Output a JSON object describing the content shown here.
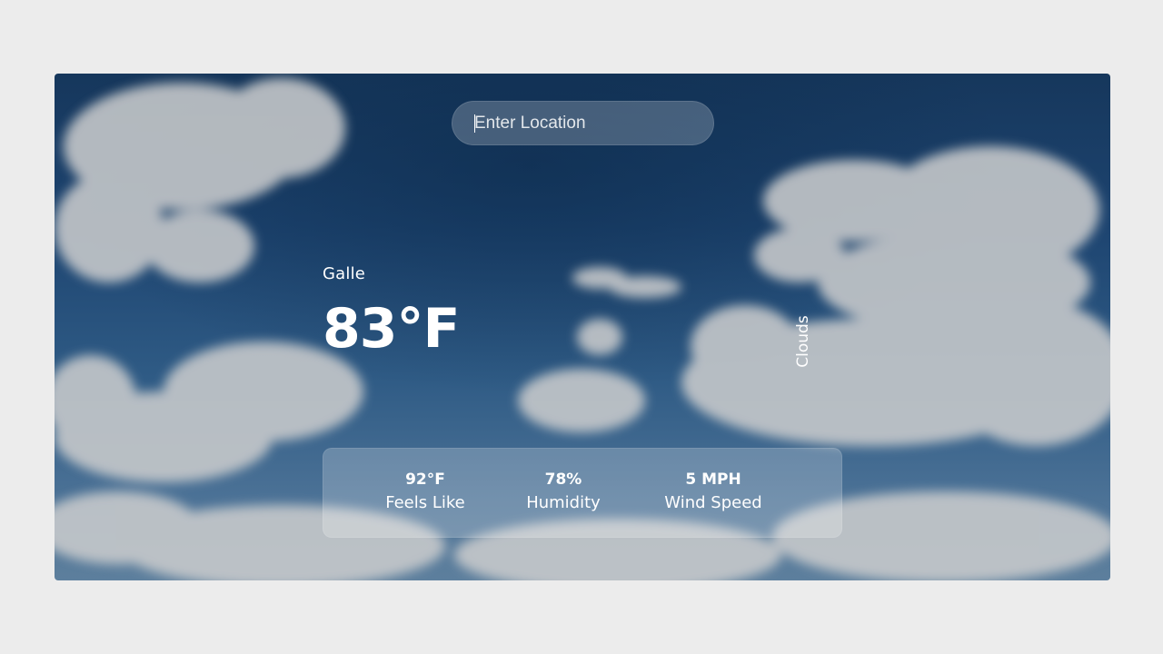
{
  "search": {
    "placeholder": "Enter Location",
    "value": ""
  },
  "weather": {
    "location": "Galle",
    "temperature": "83°F",
    "condition": "Clouds"
  },
  "stats": [
    {
      "value": "92°F",
      "label": "Feels Like"
    },
    {
      "value": "78%",
      "label": "Humidity"
    },
    {
      "value": "5 MPH",
      "label": "Wind Speed"
    }
  ],
  "colors": {
    "page_background": "#ececec",
    "sky_top": "#16375c",
    "sky_bottom": "#5d7f9d",
    "text": "#ffffff"
  }
}
